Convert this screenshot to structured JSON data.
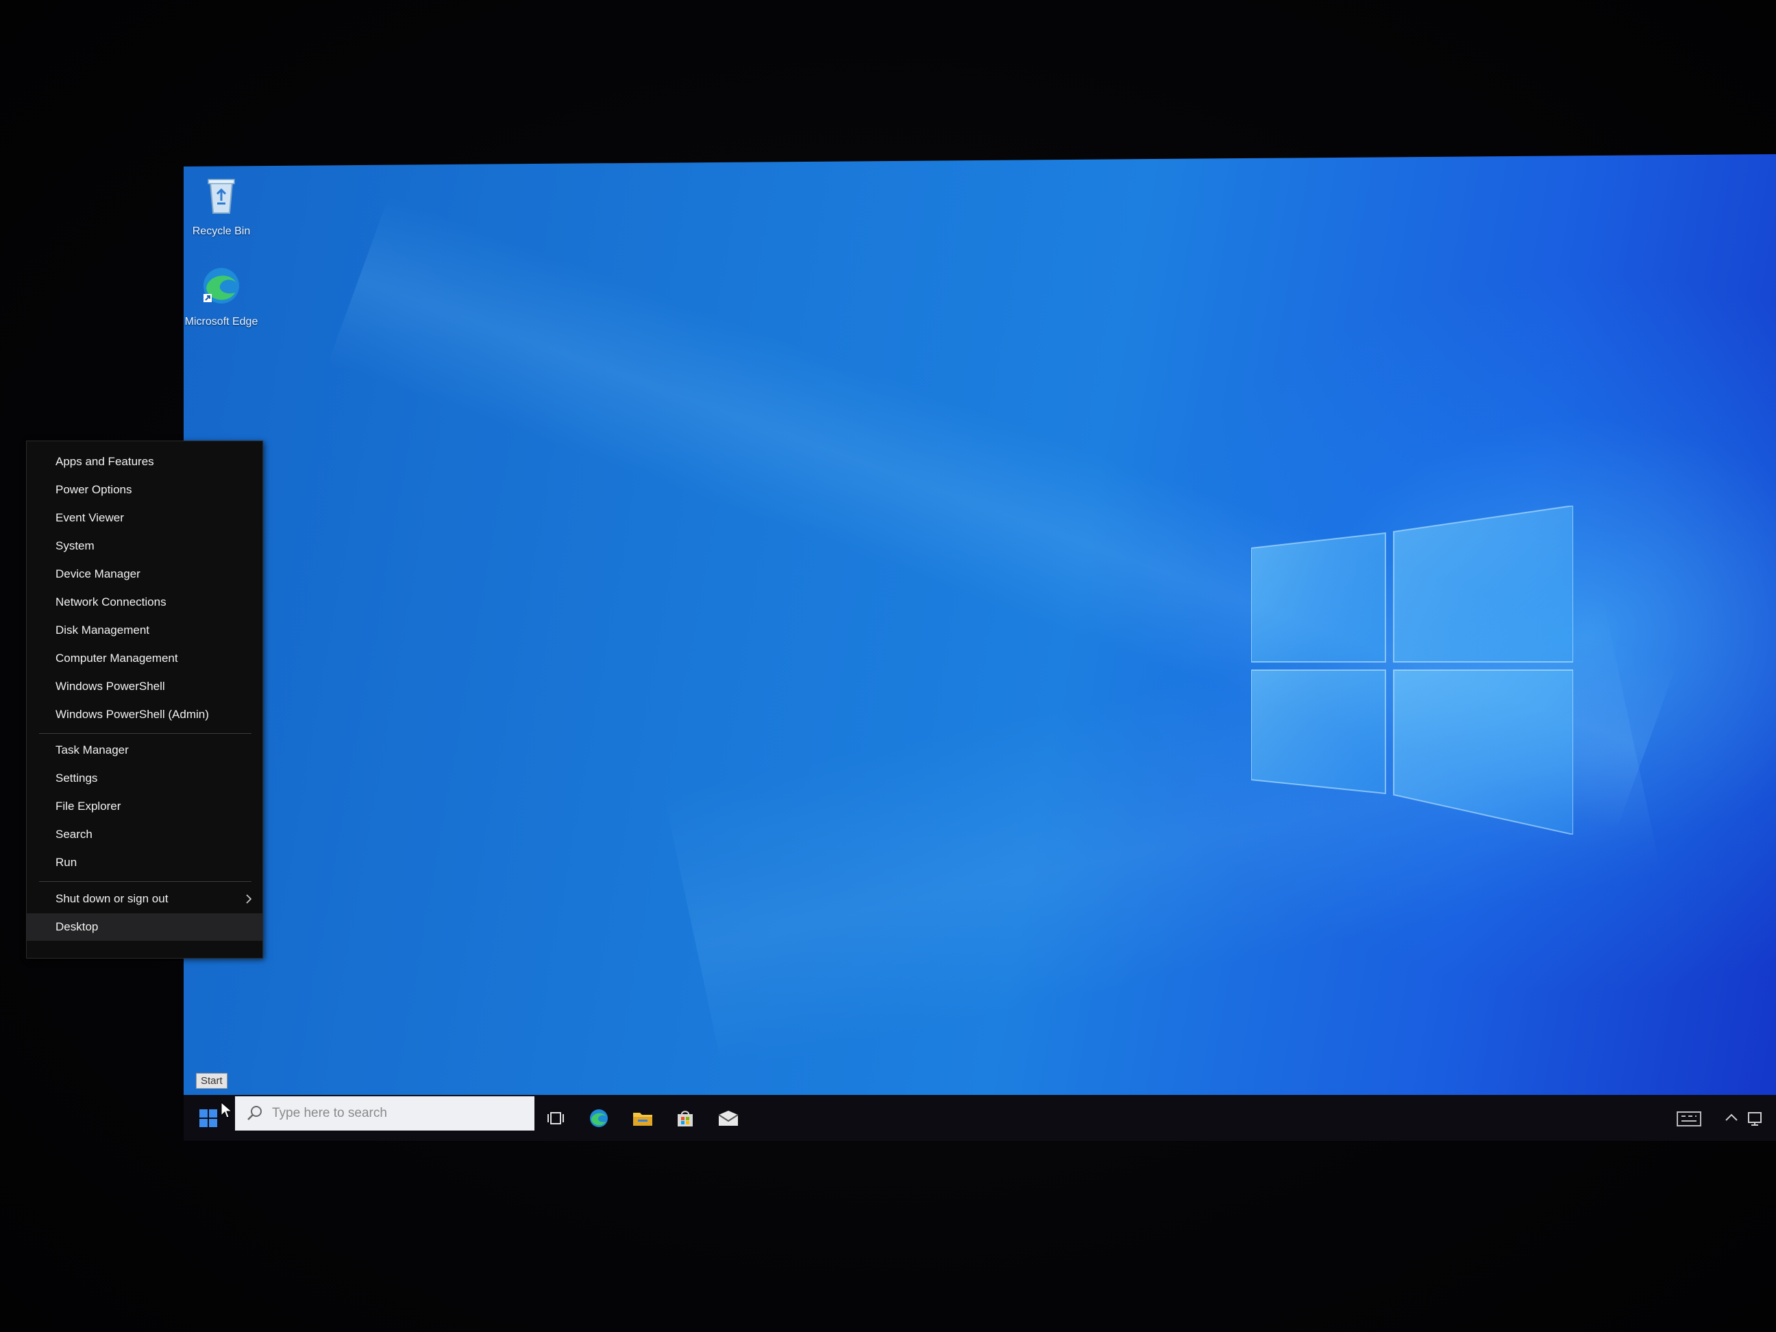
{
  "desktop": {
    "icons": [
      {
        "label": "Recycle Bin",
        "icon": "recycle-bin-icon"
      },
      {
        "label": "Microsoft Edge",
        "icon": "edge-icon"
      }
    ]
  },
  "winx_menu": {
    "groups": [
      [
        "Apps and Features",
        "Power Options",
        "Event Viewer",
        "System",
        "Device Manager",
        "Network Connections",
        "Disk Management",
        "Computer Management",
        "Windows PowerShell",
        "Windows PowerShell (Admin)"
      ],
      [
        "Task Manager",
        "Settings",
        "File Explorer",
        "Search",
        "Run"
      ],
      [
        "Shut down or sign out",
        "Desktop"
      ]
    ],
    "items": {
      "apps_and_features": "Apps and Features",
      "power_options": "Power Options",
      "event_viewer": "Event Viewer",
      "system": "System",
      "device_manager": "Device Manager",
      "network_connections": "Network Connections",
      "disk_management": "Disk Management",
      "computer_management": "Computer Management",
      "windows_powershell": "Windows PowerShell",
      "windows_powershell_admin": "Windows PowerShell (Admin)",
      "task_manager": "Task Manager",
      "settings": "Settings",
      "file_explorer": "File Explorer",
      "search": "Search",
      "run": "Run",
      "shut_down": "Shut down or sign out",
      "desktop": "Desktop"
    }
  },
  "taskbar": {
    "start_tooltip": "Start",
    "search_placeholder": "Type here to search",
    "pinned": [
      "task-view-icon",
      "edge-icon",
      "file-explorer-icon",
      "store-icon",
      "mail-icon"
    ]
  },
  "colors": {
    "wallpaper_blue": "#1a78d8",
    "menu_bg": "#0e0e0f",
    "taskbar_bg": "#0c0c12"
  }
}
